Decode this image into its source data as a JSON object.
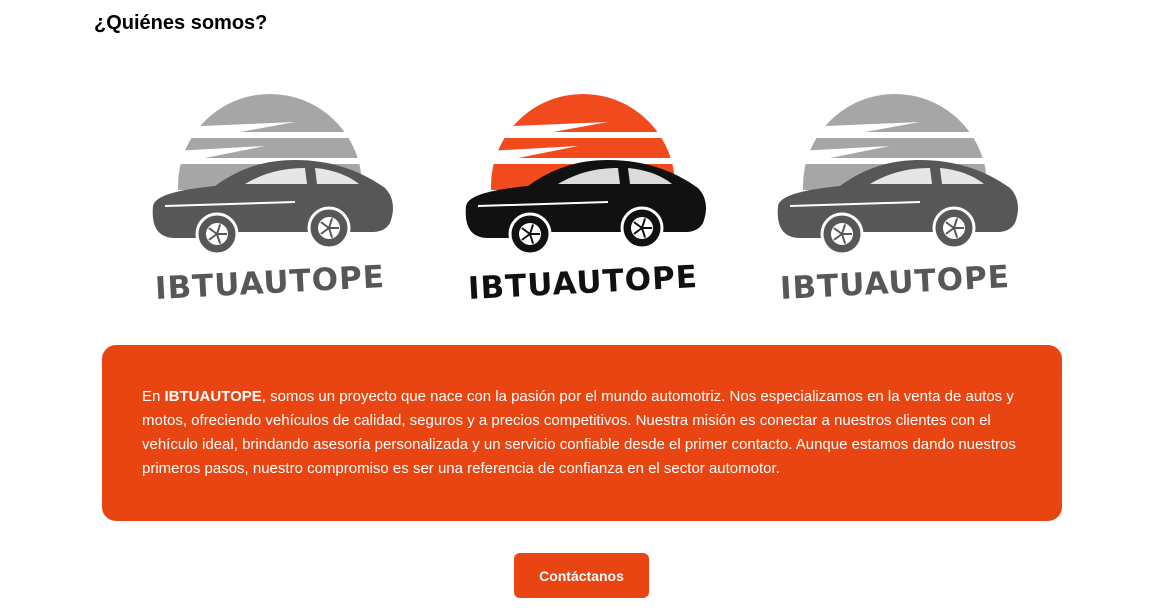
{
  "section": {
    "title": "¿Quiénes somos?"
  },
  "logos": [
    {
      "brand": "IBTUAUTOPE",
      "sun_color": "#a6a6a6",
      "car_color": "#575757",
      "text_color": "#575757",
      "icon": "car-logo-icon"
    },
    {
      "brand": "IBTUAUTOPE",
      "sun_color": "#f04a1d",
      "car_color": "#111111",
      "text_color": "#111111",
      "icon": "car-logo-icon"
    },
    {
      "brand": "IBTUAUTOPE",
      "sun_color": "#a6a6a6",
      "car_color": "#575757",
      "text_color": "#575757",
      "icon": "car-logo-icon"
    }
  ],
  "about": {
    "prefix": "En ",
    "brand": "IBTUAUTOPE",
    "body": ", somos un proyecto que nace con la pasión por el mundo automotriz. Nos especializamos en la venta de autos y motos, ofreciendo vehículos de calidad, seguros y a precios competitivos. Nuestra misión es conectar a nuestros clientes con el vehículo ideal, brindando asesoría personalizada y un servicio confiable desde el primer contacto. Aunque estamos dando nuestros primeros pasos, nuestro compromiso es ser una referencia de confianza en el sector automotor.",
    "background_color": "#e84512"
  },
  "contact_button": {
    "label": "Contáctanos",
    "color": "#e84512"
  }
}
